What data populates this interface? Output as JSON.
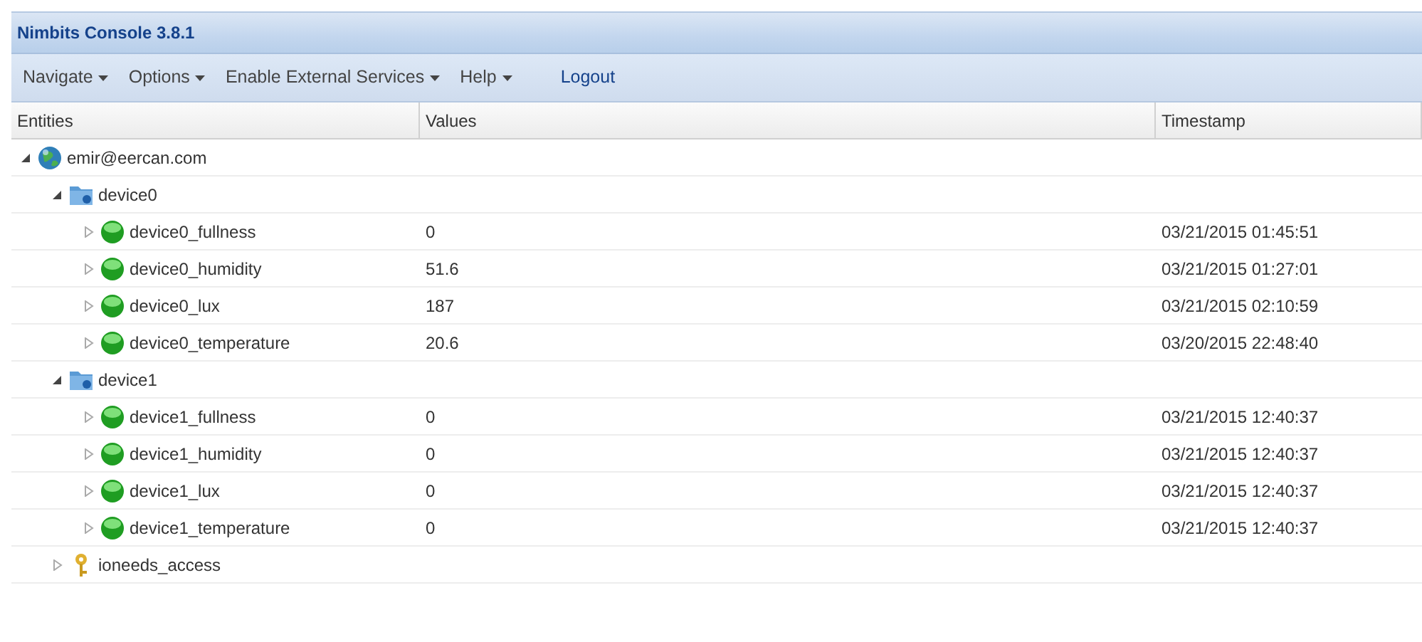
{
  "window": {
    "title": "Nimbits Console 3.8.1"
  },
  "menu": [
    {
      "label": "Navigate",
      "kind": "dropdown"
    },
    {
      "label": "Options",
      "kind": "dropdown"
    },
    {
      "label": "Enable External Services",
      "kind": "dropdown"
    },
    {
      "label": "Help",
      "kind": "dropdown"
    },
    {
      "label": "Logout",
      "kind": "link"
    }
  ],
  "table": {
    "columns": [
      "Entities",
      "Values",
      "Timestamp"
    ],
    "rows": [
      {
        "name": "emir@eercan.com",
        "kind": "user",
        "expanded": true,
        "children": [
          {
            "name": "device0",
            "kind": "folder",
            "expanded": true,
            "children": [
              {
                "name": "device0_fullness",
                "kind": "point",
                "expanded": false,
                "value": "0",
                "timestamp": "03/21/2015 01:45:51"
              },
              {
                "name": "device0_humidity",
                "kind": "point",
                "expanded": false,
                "value": "51.6",
                "timestamp": "03/21/2015 01:27:01"
              },
              {
                "name": "device0_lux",
                "kind": "point",
                "expanded": false,
                "value": "187",
                "timestamp": "03/21/2015 02:10:59"
              },
              {
                "name": "device0_temperature",
                "kind": "point",
                "expanded": false,
                "value": "20.6",
                "timestamp": "03/20/2015 22:48:40"
              }
            ]
          },
          {
            "name": "device1",
            "kind": "folder",
            "expanded": true,
            "children": [
              {
                "name": "device1_fullness",
                "kind": "point",
                "expanded": false,
                "value": "0",
                "timestamp": "03/21/2015 12:40:37"
              },
              {
                "name": "device1_humidity",
                "kind": "point",
                "expanded": false,
                "value": "0",
                "timestamp": "03/21/2015 12:40:37"
              },
              {
                "name": "device1_lux",
                "kind": "point",
                "expanded": false,
                "value": "0",
                "timestamp": "03/21/2015 12:40:37"
              },
              {
                "name": "device1_temperature",
                "kind": "point",
                "expanded": false,
                "value": "0",
                "timestamp": "03/21/2015 12:40:37"
              }
            ]
          },
          {
            "name": "ioneeds_access",
            "kind": "key",
            "expanded": false
          }
        ]
      }
    ]
  }
}
